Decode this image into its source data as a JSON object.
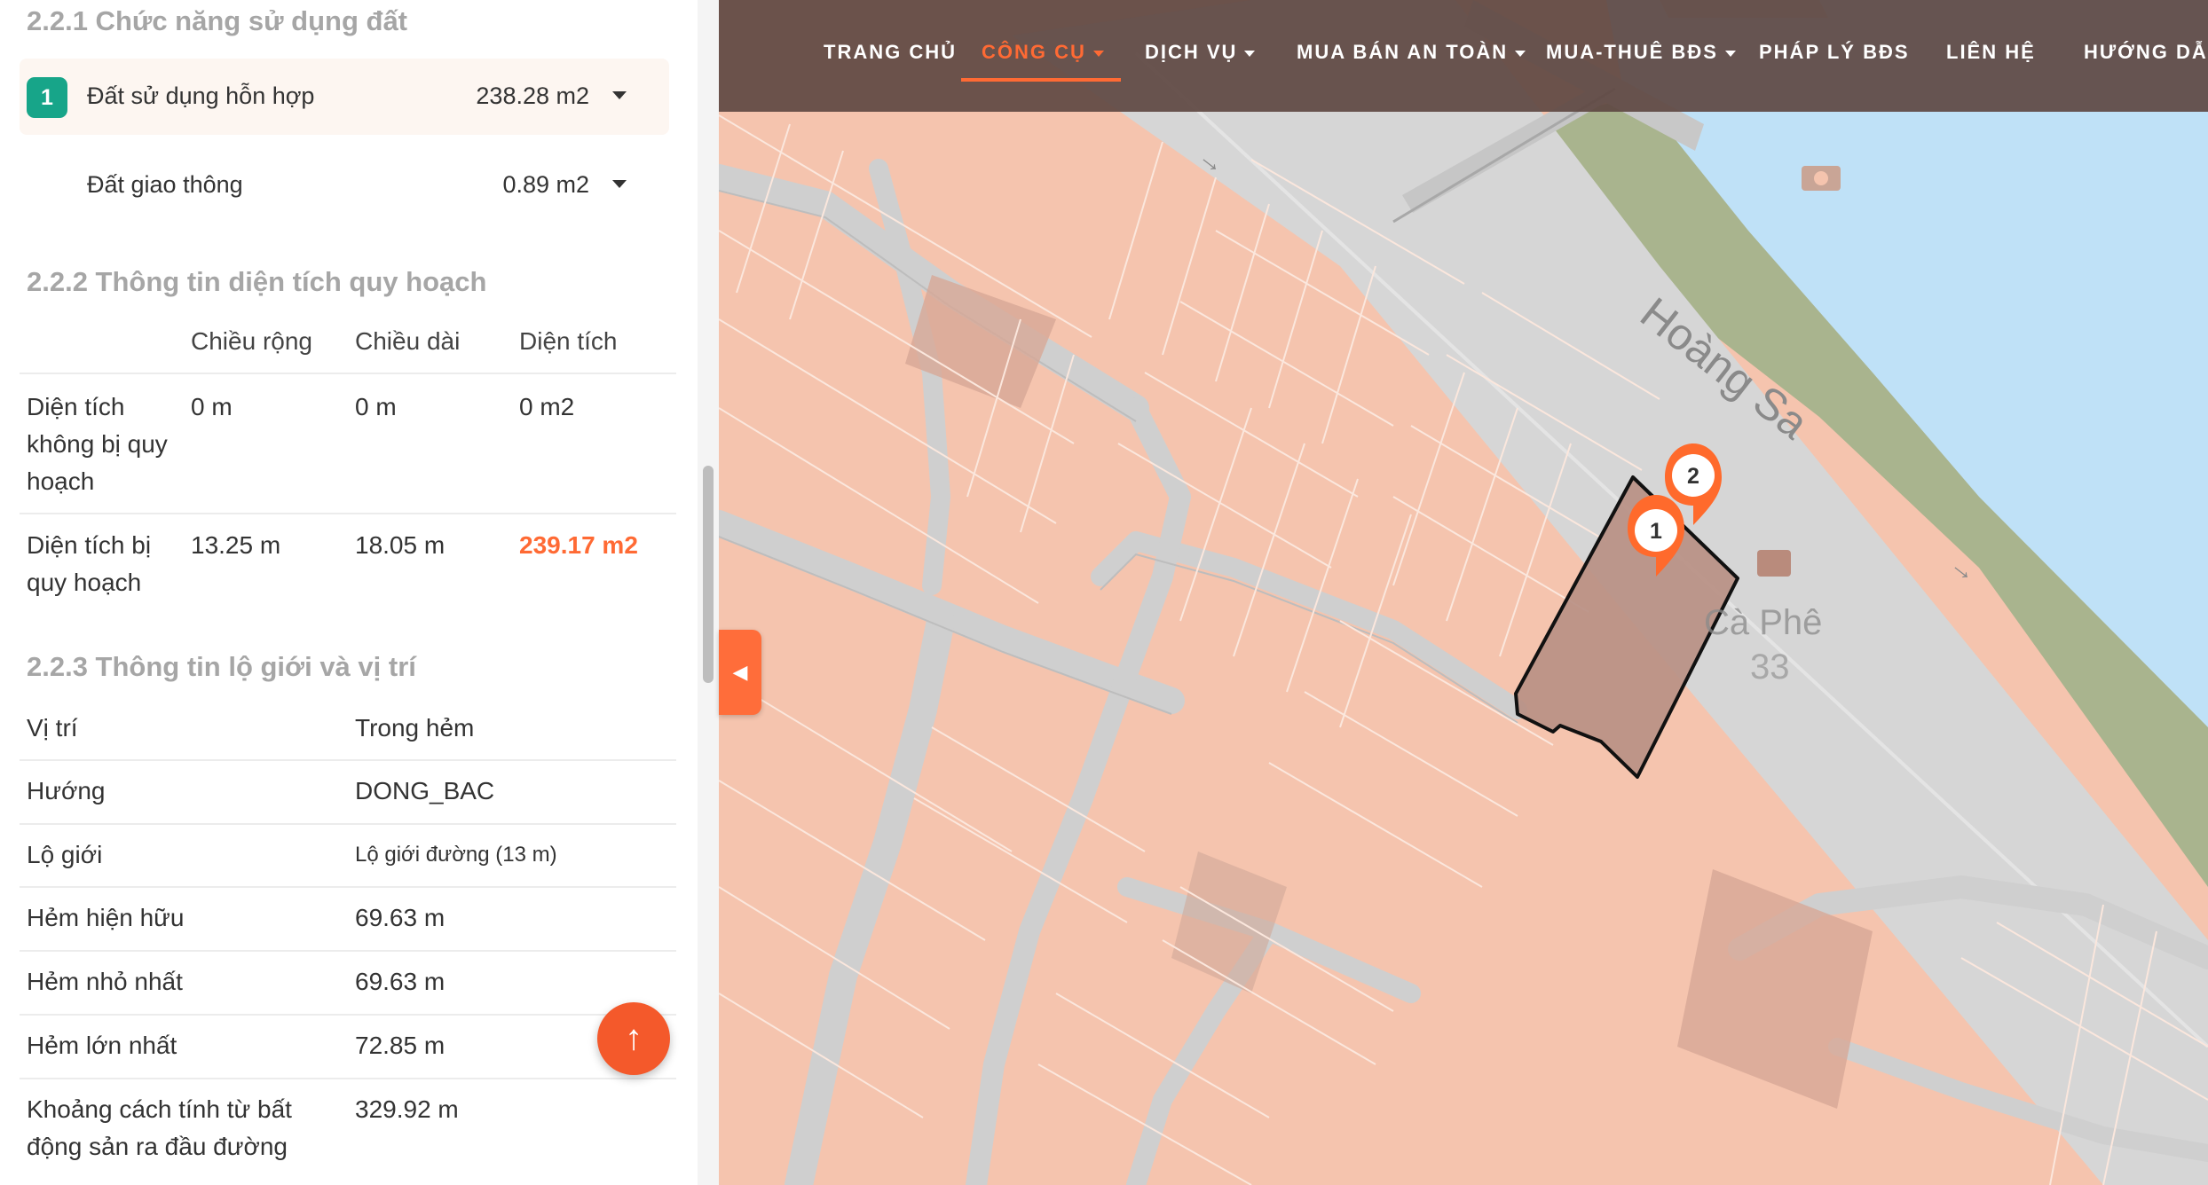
{
  "land_use": {
    "title": "2.2.1 Chức năng sử dụng đất",
    "items": [
      {
        "index": "1",
        "name": "Đất sử dụng hỗn hợp",
        "area": "238.28 m2"
      },
      {
        "index": "",
        "name": "Đất giao thông",
        "area": "0.89 m2"
      }
    ]
  },
  "planning_area": {
    "title": "2.2.2 Thông tin diện tích quy hoạch",
    "headers": [
      "Chiều rộng",
      "Chiều dài",
      "Diện tích"
    ],
    "rows": [
      {
        "label_lines": [
          "Diện tích",
          "không bị quy",
          "hoạch"
        ],
        "width": "0 m",
        "length": "0 m",
        "area": "0 m2"
      },
      {
        "label_lines": [
          "Diện tích bị",
          "quy hoạch"
        ],
        "width": "13.25 m",
        "length": "18.05 m",
        "area": "239.17 m2"
      }
    ]
  },
  "road_info": {
    "title": "2.2.3 Thông tin lộ giới và vị trí",
    "rows": [
      {
        "label": "Vị trí",
        "value": "Trong hẻm"
      },
      {
        "label": "Hướng",
        "value": "DONG_BAC"
      },
      {
        "label": "Lộ giới",
        "value": "Lộ giới đường (13 m)"
      },
      {
        "label": "Hẻm hiện hữu",
        "value": "69.63 m"
      },
      {
        "label": "Hẻm nhỏ nhất",
        "value": "69.63 m"
      },
      {
        "label": "Hẻm lớn nhất",
        "value": "72.85 m"
      },
      {
        "label_lines": [
          "Khoảng cách tính từ bất",
          "động sản ra đầu đường"
        ],
        "value": "329.92 m"
      }
    ]
  },
  "back_to_top_icon": "arrow-up-icon",
  "panel_toggle_icon": "caret-left-icon",
  "nav": {
    "items": [
      {
        "label": "TRANG CHỦ",
        "dropdown": false
      },
      {
        "label": "CÔNG CỤ",
        "dropdown": true,
        "active": true
      },
      {
        "label": "DỊCH VỤ",
        "dropdown": true
      },
      {
        "label": "MUA BÁN AN TOÀN",
        "dropdown": true
      },
      {
        "label": "MUA-THUÊ BĐS",
        "dropdown": true
      },
      {
        "label": "PHÁP LÝ BĐS",
        "dropdown": false
      },
      {
        "label": "LIÊN HỆ",
        "dropdown": false
      },
      {
        "label": "HƯỚNG DẪN",
        "dropdown": false
      }
    ]
  },
  "map": {
    "street_name": "Hoàng Sa",
    "poi_name": "Cà Phê",
    "poi_number": "33",
    "markers": [
      "1",
      "2"
    ]
  },
  "colors": {
    "accent": "#ff6a34",
    "badge": "#17a589",
    "nav_bg": "#5e4842",
    "land_fill": "#f5c4ae",
    "road": "#d3d3d3",
    "water": "#bfe1f7",
    "park": "#a9b48e"
  }
}
